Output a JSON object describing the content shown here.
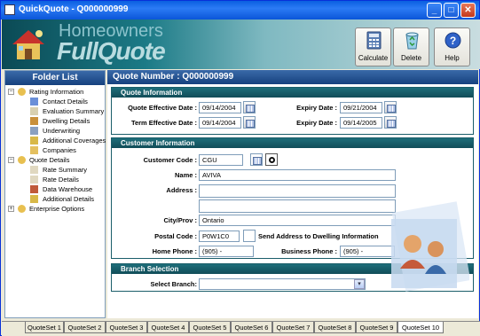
{
  "window": {
    "title": "QuickQuote - Q000000999",
    "minimize": "_",
    "maximize": "□",
    "close": "✕"
  },
  "header": {
    "brand_line1": "Homeowners",
    "brand_line2": "FullQuote",
    "buttons": [
      {
        "label": "Calculate",
        "icon": "calculator-icon"
      },
      {
        "label": "Delete",
        "icon": "recycle-bin-icon"
      },
      {
        "label": "Help",
        "icon": "help-icon"
      }
    ]
  },
  "folder_list": {
    "title": "Folder List",
    "tree": [
      {
        "label": "Rating Information",
        "level": 0,
        "expander": "−"
      },
      {
        "label": "Contact Details",
        "level": 1
      },
      {
        "label": "Evaluation Summary",
        "level": 1
      },
      {
        "label": "Dwelling Details",
        "level": 1
      },
      {
        "label": "Underwriting",
        "level": 1
      },
      {
        "label": "Additional Coverages",
        "level": 1
      },
      {
        "label": "Companies",
        "level": 1
      },
      {
        "label": "Quote Details",
        "level": 0,
        "expander": "−"
      },
      {
        "label": "Rate Summary",
        "level": 1
      },
      {
        "label": "Rate Details",
        "level": 1
      },
      {
        "label": "Data Warehouse",
        "level": 1
      },
      {
        "label": "Additional Details",
        "level": 1
      },
      {
        "label": "Enterprise Options",
        "level": 0,
        "expander": "+"
      }
    ]
  },
  "quote": {
    "heading": "Quote Number : Q000000999",
    "quote_info": {
      "title": "Quote Information",
      "quote_effective_label": "Quote Effective Date :",
      "quote_effective_value": "09/14/2004",
      "expiry1_label": "Expiry Date :",
      "expiry1_value": "09/21/2004",
      "term_effective_label": "Term Effective Date :",
      "term_effective_value": "09/14/2004",
      "expiry2_label": "Expiry Date :",
      "expiry2_value": "09/14/2005"
    },
    "customer_info": {
      "title": "Customer Information",
      "code_label": "Customer Code :",
      "code_value": "CGU",
      "name_label": "Name :",
      "name_value": "AVIVA",
      "address_label": "Address :",
      "address1_value": "",
      "address2_value": "",
      "cityprov_label": "City/Prov :",
      "cityprov_value": "Ontario",
      "postal_label": "Postal Code :",
      "postal_value": "P0W1C0",
      "send_address_label": "Send Address to Dwelling Information",
      "home_phone_label": "Home Phone :",
      "home_phone_value": "(905)    -",
      "business_phone_label": "Business Phone :",
      "business_phone_value": "(905)    -"
    },
    "branch": {
      "title": "Branch Selection",
      "select_label": "Select Branch:",
      "select_value": ""
    }
  },
  "tabs": [
    "QuoteSet 1",
    "QuoteSet 2",
    "QuoteSet 3",
    "QuoteSet 4",
    "QuoteSet 5",
    "QuoteSet 6",
    "QuoteSet 7",
    "QuoteSet 8",
    "QuoteSet 9",
    "QuoteSet 10"
  ],
  "active_tab": "QuoteSet 10"
}
